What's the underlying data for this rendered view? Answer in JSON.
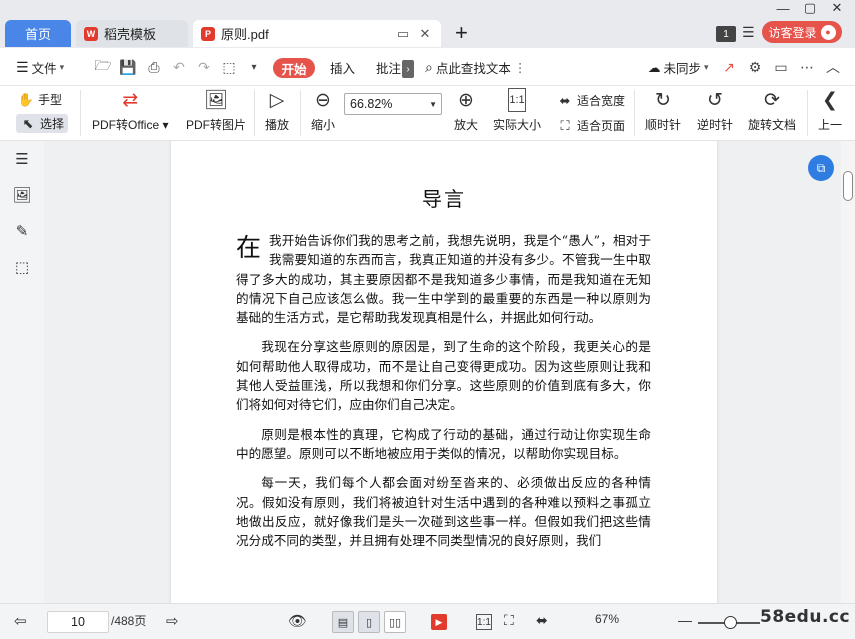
{
  "tabs": {
    "home": "首页",
    "template": "稻壳模板",
    "document": "原则.pdf",
    "tab_count": "1",
    "login": "访客登录"
  },
  "menubar": {
    "file": "文件",
    "start": "开始",
    "insert": "插入",
    "annotate": "批注",
    "search": "点此查找文本",
    "sync": "未同步"
  },
  "ribbon": {
    "hand": "手型",
    "select": "选择",
    "pdf_to_office": "PDF转Office",
    "pdf_to_image": "PDF转图片",
    "play": "播放",
    "zoom_out": "缩小",
    "zoom_value": "66.82%",
    "zoom_in": "放大",
    "actual_size": "实际大小",
    "fit_width": "适合宽度",
    "fit_page": "适合页面",
    "rotate_cw": "顺时针",
    "rotate_ccw": "逆时针",
    "rotate_doc": "旋转文档",
    "prev": "上一"
  },
  "document": {
    "title": "导言",
    "dropcap": "在",
    "paragraphs": [
      "我开始告诉你们我的思考之前，我想先说明，我是个“愚人”，相对于我需要知道的东西而言，我真正知道的并没有多少。不管我一生中取得了多大的成功，其主要原因都不是我知道多少事情，而是我知道在无知的情况下自己应该怎么做。我一生中学到的最重要的东西是一种以原则为基础的生活方式，是它帮助我发现真相是什么，并据此如何行动。",
      "我现在分享这些原则的原因是，到了生命的这个阶段，我更关心的是如何帮助他人取得成功，而不是让自己变得更成功。因为这些原则让我和其他人受益匪浅，所以我想和你们分享。这些原则的价值到底有多大，你们将如何对待它们，应由你们自己决定。",
      "原则是根本性的真理，它构成了行动的基础，通过行动让你实现生命中的愿望。原则可以不断地被应用于类似的情况，以帮助你实现目标。",
      "每一天，我们每个人都会面对纷至沓来的、必须做出反应的各种情况。假如没有原则，我们将被迫针对生活中遇到的各种难以预料之事孤立地做出反应，就好像我们是头一次碰到这些事一样。但假如我们把这些情况分成不同的类型，并且拥有处理不同类型情况的良好原则，我们"
    ]
  },
  "statusbar": {
    "current_page": "10",
    "total_pages": "/488页",
    "zoom_percent": "67%",
    "watermark": "58edu.cc"
  },
  "colors": {
    "accent_red": "#e5534b",
    "tab_blue": "#4a86e8",
    "float_blue": "#2f7de1"
  }
}
